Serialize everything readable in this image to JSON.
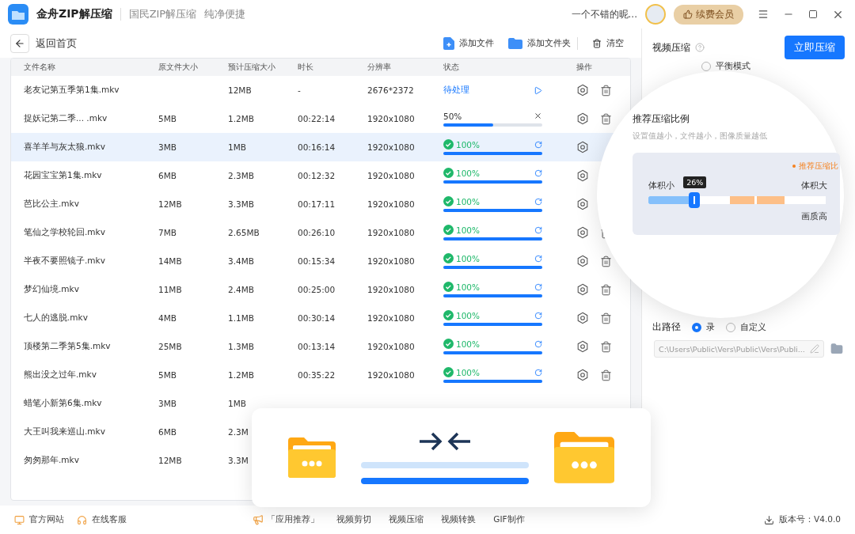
{
  "app": {
    "name": "金舟ZIP解压缩",
    "slogans": [
      "国民ZIP解压缩",
      "纯净便捷"
    ]
  },
  "user": {
    "name": "一个不错的昵...",
    "vip_button": "续费会员"
  },
  "toolbar": {
    "back": "返回首页",
    "add_file": "添加文件",
    "add_folder": "添加文件夹",
    "clear": "清空"
  },
  "table": {
    "columns": [
      "文件名称",
      "原文件大小",
      "预计压缩大小",
      "时长",
      "分辨率",
      "状态",
      "操作"
    ],
    "rows": [
      {
        "name": "老友记第五季第1集.mkv",
        "size": "",
        "compressed": "12MB",
        "duration": "-",
        "resolution": "2676*2372",
        "status": {
          "kind": "pending",
          "text": "待处理"
        },
        "actions": [
          {
            "kind": "settings"
          },
          {
            "kind": "delete"
          }
        ],
        "selected": false
      },
      {
        "name": "捉妖记第二季... .mkv",
        "size": "5MB",
        "compressed": "1.2MB",
        "duration": "00:22:14",
        "resolution": "1920x1080",
        "status": {
          "kind": "progress",
          "text": "50%",
          "level": 0.5
        },
        "actions": [
          {
            "kind": "settings"
          },
          {
            "kind": "delete"
          }
        ],
        "selected": false
      },
      {
        "name": "喜羊羊与灰太狼.mkv",
        "size": "3MB",
        "compressed": "1MB",
        "duration": "00:16:14",
        "resolution": "1920x1080",
        "status": {
          "kind": "done",
          "text": "100%",
          "level": 1
        },
        "actions": [
          {
            "kind": "settings"
          }
        ],
        "selected": true
      },
      {
        "name": "花园宝宝第1集.mkv",
        "size": "6MB",
        "compressed": "2.3MB",
        "duration": "00:12:32",
        "resolution": "1920x1080",
        "status": {
          "kind": "done",
          "text": "100%",
          "level": 1
        },
        "actions": [
          {
            "kind": "settings"
          }
        ],
        "selected": false
      },
      {
        "name": "芭比公主.mkv",
        "size": "12MB",
        "compressed": "3.3MB",
        "duration": "00:17:11",
        "resolution": "1920x1080",
        "status": {
          "kind": "done",
          "text": "100%",
          "level": 1
        },
        "actions": [
          {
            "kind": "settings"
          }
        ],
        "selected": false
      },
      {
        "name": "笔仙之学校轮回.mkv",
        "size": "7MB",
        "compressed": "2.65MB",
        "duration": "00:26:10",
        "resolution": "1920x1080",
        "status": {
          "kind": "done",
          "text": "100%",
          "level": 1
        },
        "actions": [
          {
            "kind": "settings"
          },
          {
            "kind": "delete"
          }
        ],
        "selected": false
      },
      {
        "name": "半夜不要照镜子.mkv",
        "size": "14MB",
        "compressed": "3.4MB",
        "duration": "00:15:34",
        "resolution": "1920x1080",
        "status": {
          "kind": "done",
          "text": "100%",
          "level": 1
        },
        "actions": [
          {
            "kind": "settings"
          },
          {
            "kind": "delete"
          }
        ],
        "selected": false
      },
      {
        "name": "梦幻仙境.mkv",
        "size": "11MB",
        "compressed": "2.4MB",
        "duration": "00:25:00",
        "resolution": "1920x1080",
        "status": {
          "kind": "done",
          "text": "100%",
          "level": 1
        },
        "actions": [
          {
            "kind": "settings"
          },
          {
            "kind": "delete"
          }
        ],
        "selected": false
      },
      {
        "name": "七人的逃脱.mkv",
        "size": "4MB",
        "compressed": "1.1MB",
        "duration": "00:30:14",
        "resolution": "1920x1080",
        "status": {
          "kind": "done",
          "text": "100%",
          "level": 1
        },
        "actions": [
          {
            "kind": "settings"
          },
          {
            "kind": "delete"
          }
        ],
        "selected": false
      },
      {
        "name": "顶楼第二季第5集.mkv",
        "size": "25MB",
        "compressed": "1.3MB",
        "duration": "00:13:14",
        "resolution": "1920x1080",
        "status": {
          "kind": "done",
          "text": "100%",
          "level": 1
        },
        "actions": [
          {
            "kind": "settings"
          },
          {
            "kind": "delete"
          }
        ],
        "selected": false
      },
      {
        "name": "熊出没之过年.mkv",
        "size": "5MB",
        "compressed": "1.2MB",
        "duration": "00:35:22",
        "resolution": "1920x1080",
        "status": {
          "kind": "done",
          "text": "100%",
          "level": 1
        },
        "actions": [
          {
            "kind": "settings"
          },
          {
            "kind": "delete"
          }
        ],
        "selected": false
      },
      {
        "name": "蜡笔小新第6集.mkv",
        "size": "3MB",
        "compressed": "1MB",
        "selected": false
      },
      {
        "name": "大王叫我来巡山.mkv",
        "size": "6MB",
        "compressed": "2.3M",
        "selected": false
      },
      {
        "name": "匆匆那年.mkv",
        "size": "12MB",
        "compressed": "3.3M",
        "selected": false
      }
    ]
  },
  "panel": {
    "title": "视频压缩",
    "start_button": "立即压缩",
    "mode_option": {
      "label": "平衡模式",
      "selected": false
    },
    "output": {
      "heading": "出路径",
      "options": [
        {
          "label": "录",
          "selected": true
        },
        {
          "label": "自定义",
          "selected": false
        }
      ],
      "path": "C:\\Users\\Public\\Vers\\Public\\Vers\\Publi..."
    }
  },
  "magnifier": {
    "title": "推荐压缩比例",
    "hint": "设置值越小，文件越小，图像质量越低",
    "legend": "推荐压缩比",
    "min_label": "体积小",
    "max_label": "体积大",
    "quality_label": "画质高",
    "tooltip": "26%",
    "level": 0.26
  },
  "footer": {
    "left": [
      {
        "kind": "website",
        "label": "官方网站"
      },
      {
        "kind": "support",
        "label": "在线客服"
      }
    ],
    "promo": "「应用推荐」",
    "links": [
      "视频剪切",
      "视频压缩",
      "视频转换",
      "GIF制作"
    ],
    "version": "版本号：V4.0.0"
  }
}
